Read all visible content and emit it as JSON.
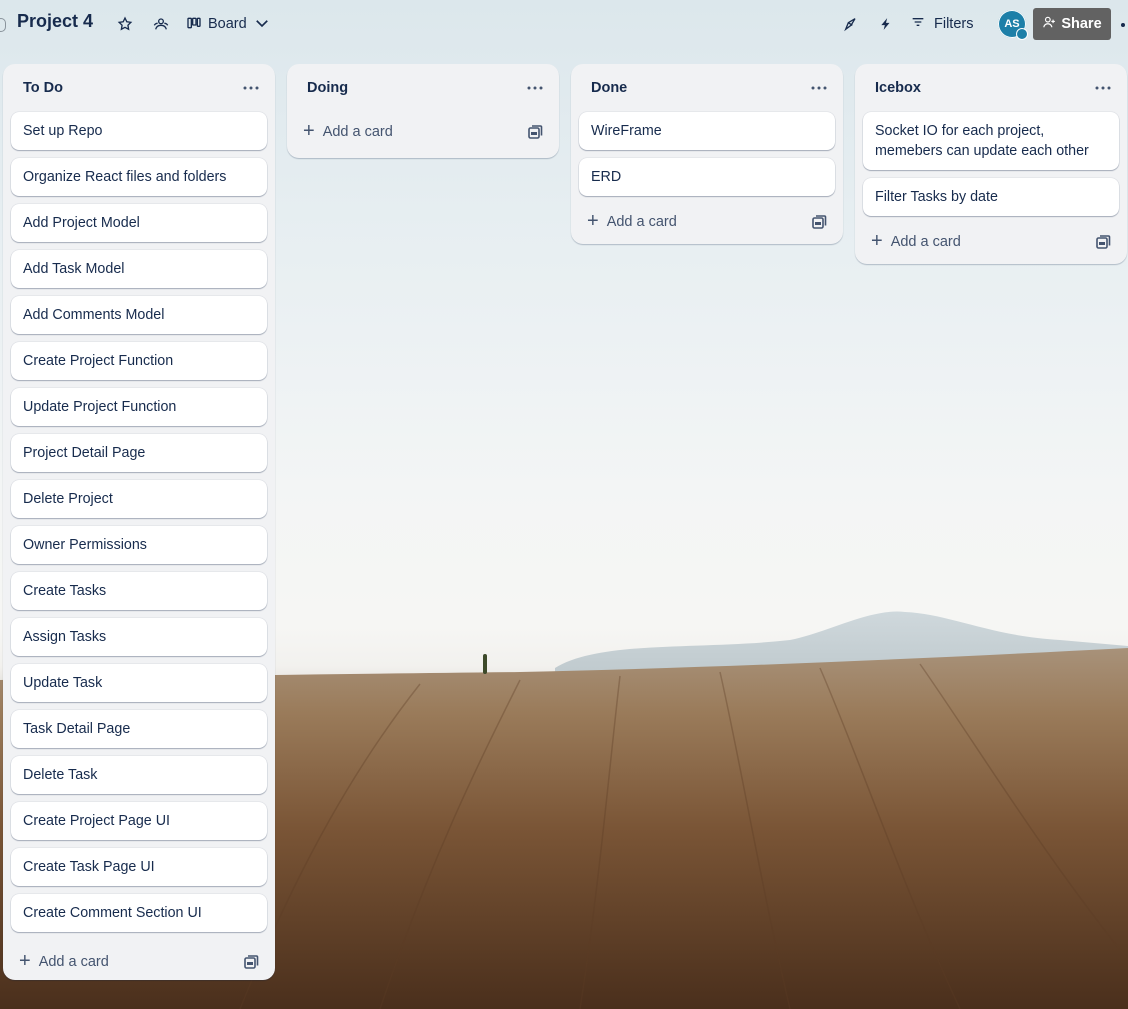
{
  "board": {
    "title": "Project 4",
    "view_label": "Board",
    "filters_label": "Filters",
    "avatar_initials": "AS",
    "share_label": "Share"
  },
  "lists": [
    {
      "title": "To Do",
      "cards": [
        "Set up Repo",
        "Organize React files and folders",
        "Add Project Model",
        "Add Task Model",
        "Add Comments Model",
        "Create Project Function",
        "Update Project Function",
        "Project Detail Page",
        "Delete Project",
        "Owner Permissions",
        "Create Tasks",
        "Assign Tasks",
        "Update Task",
        "Task Detail Page",
        "Delete Task",
        "Create Project Page UI",
        "Create Task Page UI",
        "Create Comment Section UI"
      ],
      "add_label": "Add a card"
    },
    {
      "title": "Doing",
      "cards": [],
      "add_label": "Add a card"
    },
    {
      "title": "Done",
      "cards": [
        "WireFrame",
        "ERD"
      ],
      "add_label": "Add a card"
    },
    {
      "title": "Icebox",
      "cards": [
        "Socket IO for each project, memebers can update each other",
        "Filter Tasks by date"
      ],
      "add_label": "Add a card"
    }
  ],
  "icons": {
    "star": "star-icon",
    "workspace": "workspace-visibility-icon",
    "board": "board-view-icon",
    "chevron": "chevron-down-icon",
    "rocket": "power-ups-icon",
    "bolt": "automation-icon",
    "filter": "filter-icon",
    "share": "person-add-icon",
    "more": "more-icon",
    "template": "card-template-icon"
  },
  "colors": {
    "share_bg": "#626262",
    "list_bg": "#f1f2f4",
    "text": "#172b4d",
    "avatar_bg": "#1d7fa8"
  }
}
